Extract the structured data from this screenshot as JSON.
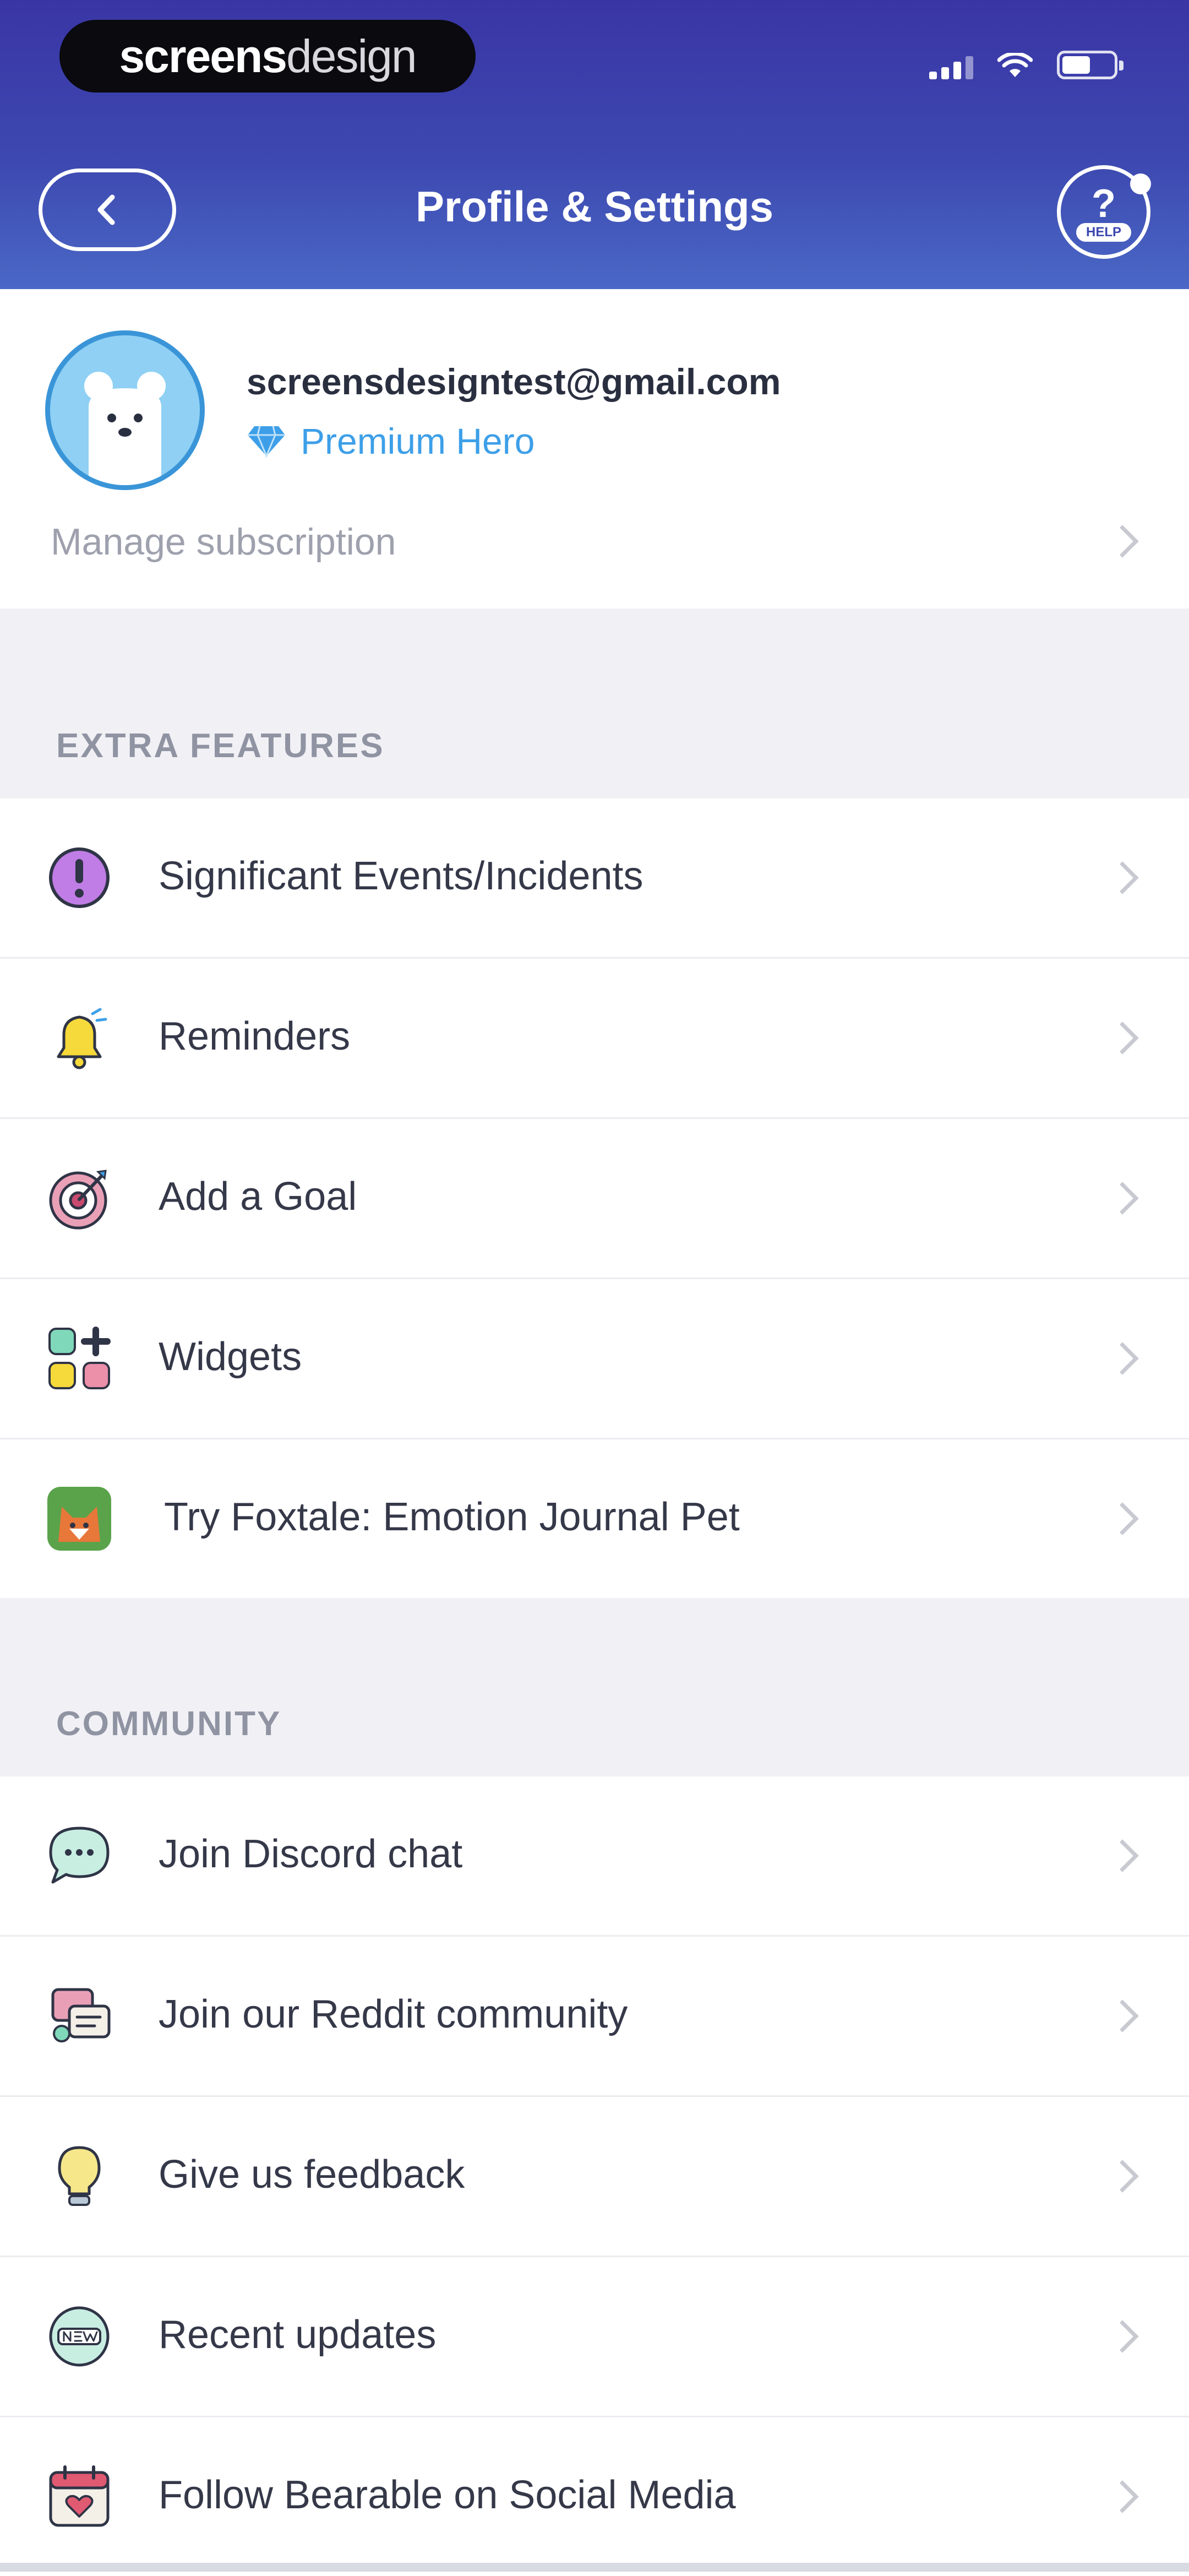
{
  "status_bar": {
    "brand_bold": "screens",
    "brand_light": "design"
  },
  "nav": {
    "title": "Profile & Settings",
    "help_symbol": "?",
    "help_tag": "HELP"
  },
  "profile": {
    "email": "screensdesigntest@gmail.com",
    "plan": "Premium Hero",
    "manage_label": "Manage subscription"
  },
  "sections": {
    "extra_title": "EXTRA FEATURES",
    "community_title": "COMMUNITY"
  },
  "extra_items": [
    {
      "label": "Significant Events/Incidents",
      "icon": "alert-icon"
    },
    {
      "label": "Reminders",
      "icon": "bell-icon"
    },
    {
      "label": "Add a Goal",
      "icon": "target-icon"
    },
    {
      "label": "Widgets",
      "icon": "widgets-icon"
    },
    {
      "label": "Try Foxtale: Emotion Journal Pet",
      "icon": "foxtale-app-icon"
    }
  ],
  "community_items": [
    {
      "label": "Join Discord chat",
      "icon": "chat-bubble-icon"
    },
    {
      "label": "Join our Reddit community",
      "icon": "community-icon"
    },
    {
      "label": "Give us feedback",
      "icon": "lightbulb-icon"
    },
    {
      "label": "Recent updates",
      "icon": "new-badge-icon"
    },
    {
      "label": "Follow Bearable on Social Media",
      "icon": "calendar-heart-icon"
    }
  ],
  "colors": {
    "header_top": "#3a35a5",
    "header_bottom": "#4a68c6",
    "accent": "#3d9fe8",
    "page_bg": "#f1f1f5"
  }
}
